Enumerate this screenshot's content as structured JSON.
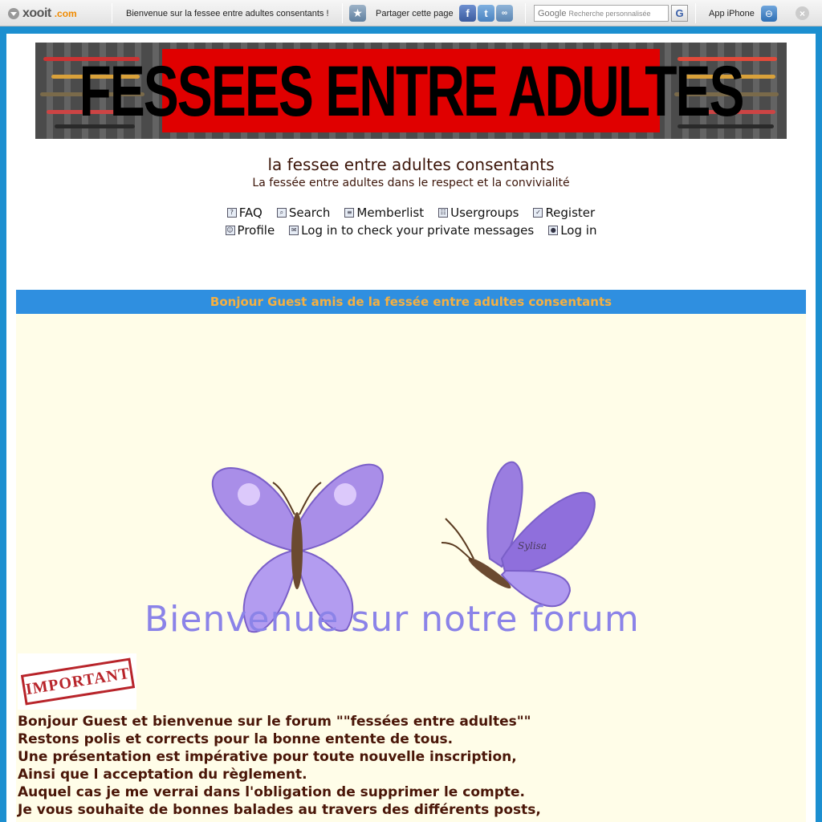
{
  "toolbar": {
    "logo_name": "xooit",
    "logo_tld": ".com",
    "page_title": "Bienvenue sur la fessee entre adultes consentants !",
    "share_label": "Partager cette page",
    "search_brand": "Google",
    "search_placeholder": "Recherche personnalisée",
    "search_button": "G",
    "app_label": "App iPhone",
    "close": "×",
    "star": "★",
    "fb": "f",
    "tw": "t",
    "other": "∞"
  },
  "banner": {
    "text": "FESSEES ENTRE ADULTES"
  },
  "site": {
    "title": "la fessee entre adultes consentants",
    "description": "La fessée entre adultes dans le respect et la convivialité"
  },
  "nav": {
    "faq": "FAQ",
    "search": "Search",
    "memberlist": "Memberlist",
    "usergroups": "Usergroups",
    "register": "Register",
    "profile": "Profile",
    "private_messages": "Log in to check your private messages",
    "login": "Log in"
  },
  "message": {
    "header": "Bonjour Guest amis de la fessée entre adultes consentants",
    "welcome_art": "Bienvenue sur notre forum",
    "art_signature": "Sylisa",
    "stamp": "IMPORTANT",
    "lines": [
      "Bonjour Guest  et bienvenue sur le forum \"\"fessées entre adultes\"\"",
      "Restons polis et corrects pour la bonne entente de tous.",
      "Une présentation est impérative pour toute nouvelle inscription,",
      "Ainsi que l acceptation du règlement.",
      "Auquel cas je me verrai dans l'obligation de supprimer le compte.",
      "Je vous souhaite de bonnes balades au travers des différents posts,"
    ]
  },
  "colors": {
    "page_bg": "#1c8fd0",
    "header_bar": "#2f8fe0",
    "header_text": "#f5b041",
    "body_bg": "#fffde8",
    "text_brown": "#4a1608",
    "banner_red": "#e00000",
    "butterfly": "#9a7de0"
  }
}
